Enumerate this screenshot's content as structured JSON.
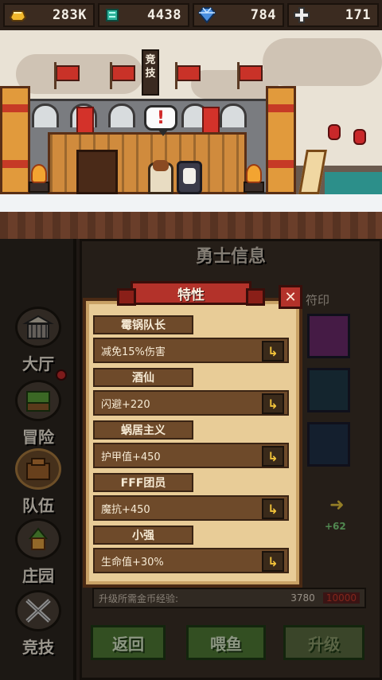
{
  "currency": {
    "gold": {
      "icon": "gold-ingot-icon",
      "value": "283K"
    },
    "emerald": {
      "icon": "green-gem-icon",
      "value": "4438"
    },
    "diamond": {
      "icon": "blue-diamond-icon",
      "value": "784"
    },
    "cross": {
      "icon": "plus-cross-icon",
      "value": "171"
    }
  },
  "scene": {
    "arena_sign": "竞技",
    "speech_symbol": "!"
  },
  "panel": {
    "title": "勇士信息",
    "seal_label": "符印",
    "arrow": "➜",
    "plus_value": "+62",
    "exp_label": "升级所需金币经验:",
    "exp_value": "3780",
    "exp_gold": "10000"
  },
  "sidebar": {
    "items": [
      {
        "label": "大厅",
        "icon": "hall-icon"
      },
      {
        "label": "冒险",
        "icon": "adventure-icon",
        "badge": true
      },
      {
        "label": "队伍",
        "icon": "team-icon",
        "active": true
      },
      {
        "label": "庄园",
        "icon": "manor-icon"
      },
      {
        "label": "竞技",
        "icon": "crossed-swords-icon"
      }
    ]
  },
  "buttons": {
    "back": "返回",
    "feed": "喂鱼",
    "upgrade": "升级"
  },
  "modal": {
    "title": "特性",
    "close": "✕",
    "traits": [
      {
        "name": "霉锅队长",
        "desc": "减免15%伤害"
      },
      {
        "name": "酒仙",
        "desc": "闪避+220"
      },
      {
        "name": "蜗居主义",
        "desc": "护甲值+450"
      },
      {
        "name": "FFF团员",
        "desc": "魔抗+450"
      },
      {
        "name": "小强",
        "desc": "生命值+30%"
      }
    ]
  },
  "colors": {
    "accent_red": "#b3322a",
    "parchment": "#e8cc97",
    "trait_bar": "#6e4a2a",
    "button_green": "#4f7a35"
  }
}
